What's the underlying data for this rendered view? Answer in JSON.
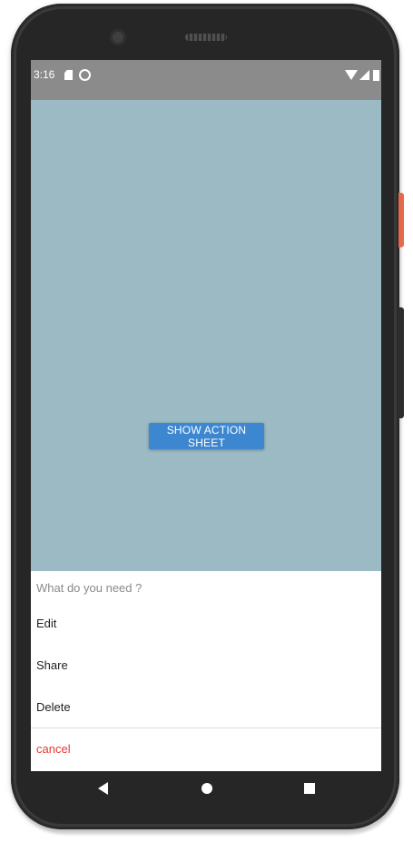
{
  "status_bar": {
    "time": "3:16",
    "icons": [
      "sd-card-icon",
      "sync-icon",
      "wifi-icon",
      "signal-icon",
      "battery-icon"
    ]
  },
  "main": {
    "button_label": "SHOW ACTION SHEET",
    "background_color": "#9bbac4",
    "button_color": "#3c87cf"
  },
  "action_sheet": {
    "title": "What do you need ?",
    "items": [
      {
        "label": "Edit"
      },
      {
        "label": "Share"
      },
      {
        "label": "Delete"
      }
    ],
    "cancel_label": "cancel",
    "cancel_color": "#e53935"
  },
  "nav_bar": {
    "icons": [
      "back-icon",
      "home-icon",
      "recents-icon"
    ]
  }
}
